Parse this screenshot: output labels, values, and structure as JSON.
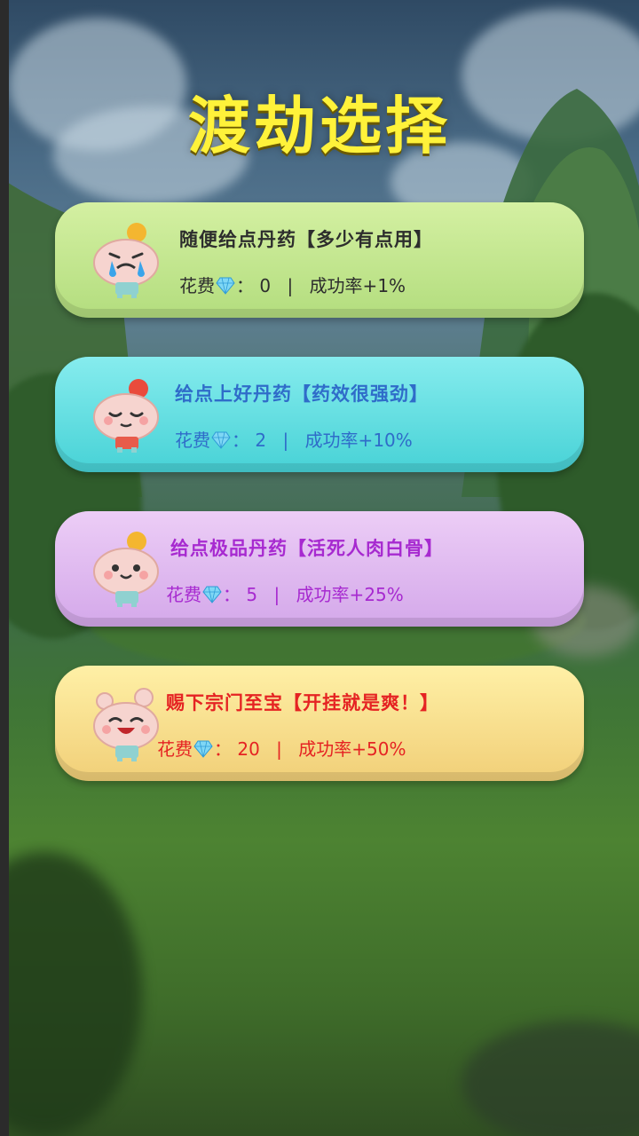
{
  "title": "渡劫选择",
  "options": [
    {
      "name": "随便给点丹药【多少有点用】",
      "cost_label": "花费",
      "cost": "0",
      "rate": "成功率+1%",
      "mascot": "crying-face-icon",
      "color": "#2d2d2d"
    },
    {
      "name": "给点上好丹药【药效很强劲】",
      "cost_label": "花费",
      "cost": "2",
      "rate": "成功率+10%",
      "mascot": "calm-face-icon",
      "color": "#2f6cc9"
    },
    {
      "name": "给点极品丹药【活死人肉白骨】",
      "cost_label": "花费",
      "cost": "5",
      "rate": "成功率+25%",
      "mascot": "smile-face-icon",
      "color": "#a72ad0"
    },
    {
      "name": "赐下宗门至宝【开挂就是爽！】",
      "cost_label": "花费",
      "cost": "20",
      "rate": "成功率+50%",
      "mascot": "laughing-face-icon",
      "color": "#e52323"
    }
  ],
  "colon": "：",
  "separator": "|",
  "gem_icon": "diamond-icon"
}
